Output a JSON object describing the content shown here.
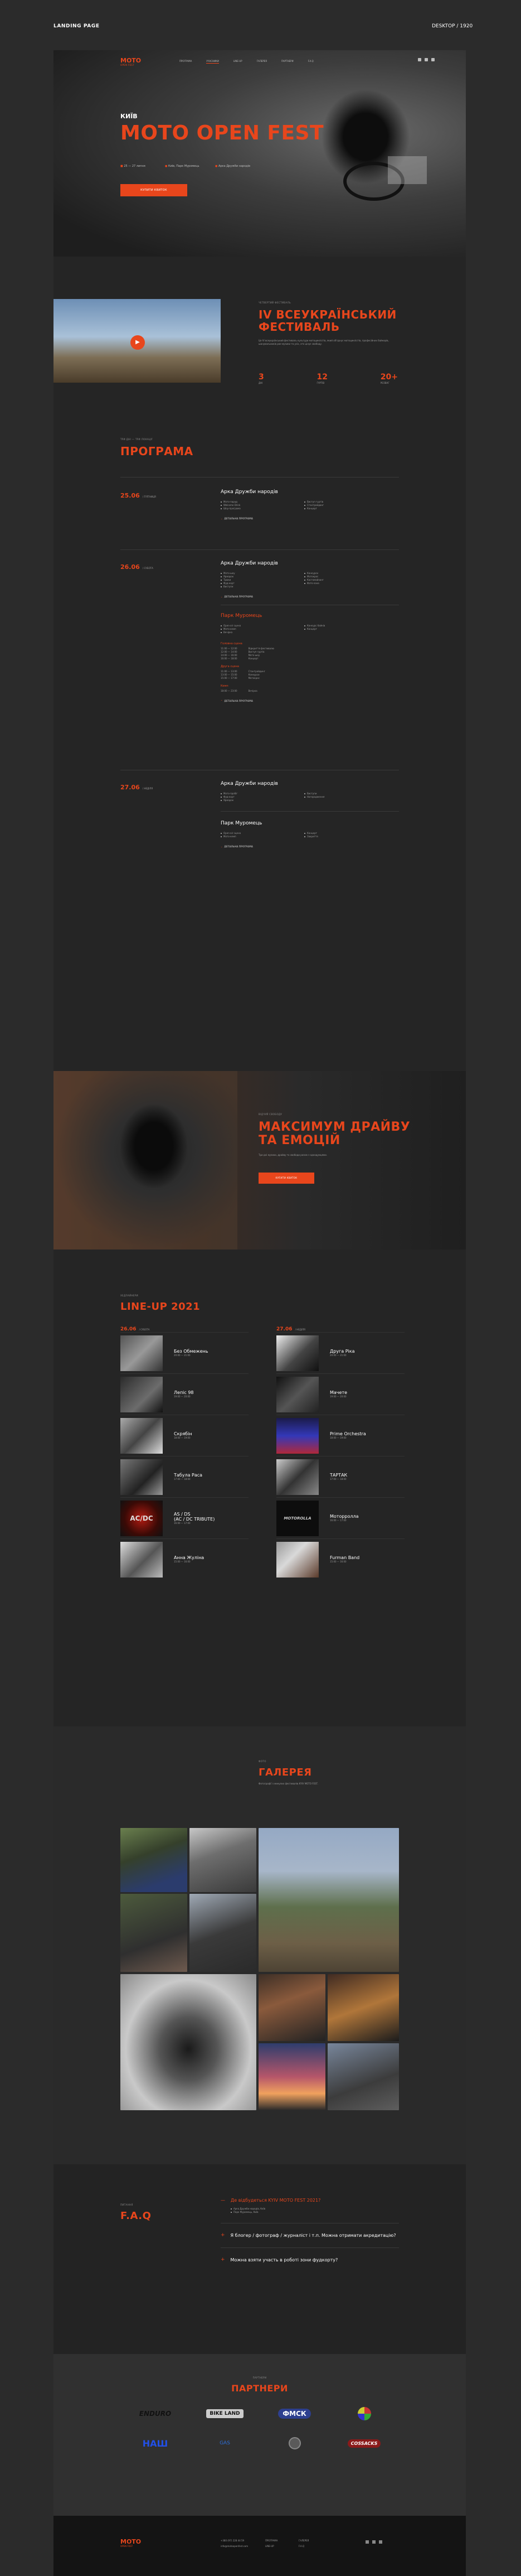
{
  "header": {
    "left": "LANDING PAGE",
    "right": "DESKTOP / 1920"
  },
  "nav": {
    "logo_top": "MOTO",
    "logo_bottom": "OPEN FEST",
    "items": [
      "ПРОГРАМА",
      "УЧАСНИКИ",
      "LINE-UP",
      "ГАЛЕРЕЯ",
      "ПАРТНЕРИ",
      "F.A.Q"
    ],
    "active": 1
  },
  "hero": {
    "city": "КИЇВ",
    "title": "MOTO OPEN FEST",
    "date": "25 — 27 липня",
    "place": "Київ, Парк Муромець",
    "extra": "Арка Дружби народів",
    "cta": "КУПИТИ КВИТОК"
  },
  "festival": {
    "sub": "ЧЕТВЕРТИЙ ФЕСТИВАЛЬ",
    "title1": "IV ВСЕУКРАЇНСЬКИЙ",
    "title2": "ФЕСТИВАЛЬ",
    "desc": "Це IV всеукраїнський фестиваль культури мотоциклістів, який об'єднує мотоциклістів, професійних байкерів, шанувальників рок-музики та усіх, хто цінує свободу.",
    "stats": [
      {
        "n": "3",
        "t": "ДНІ"
      },
      {
        "n": "12",
        "t": "ГУРТІВ"
      },
      {
        "n": "20+",
        "t": "РОЗВАГ"
      }
    ]
  },
  "program": {
    "sub": "ТРИ ДНІ — ТРИ ЛОКАЦІЇ",
    "title": "ПРОГРАМА",
    "more": "ДЕТАЛЬНА ПРОГРАМА",
    "days": [
      {
        "date": "25.06",
        "day": "/ П'ЯТНИЦЯ",
        "blocks": [
          {
            "place": "Арка Дружби народів",
            "a": [
              "Мото-парад",
              "Welcome Drink",
              "Шоу-програма"
            ],
            "b": [
              "Виступ гуртів",
              "Стантрайдинг",
              "Концерт"
            ]
          }
        ]
      },
      {
        "date": "26.06",
        "day": "/ СУБОТА",
        "blocks": [
          {
            "place": "Арка Дружби народів",
            "a": [
              "Мото-шоу",
              "Ярмарок",
              "Трюки",
              "Фуд-корт",
              "Виступи"
            ],
            "b": [
              "Конкурси",
              "Мотокрос",
              "Кастомайзинг",
              "Фото-зона"
            ]
          },
          {
            "place": "Парк Муромець",
            "a": [
              "Open-air сцена",
              "Мото-кемп",
              "Вечірка"
            ],
            "b": [
              "Конкурс байків",
              "Концерт"
            ]
          }
        ],
        "schedule": [
          {
            "h": "Головна сцена",
            "rows": [
              {
                "t": "11:00 — 12:00",
                "e": "Відкриття фестивалю"
              },
              {
                "t": "12:00 — 14:00",
                "e": "Виступ гуртів"
              },
              {
                "t": "14:00 — 16:00",
                "e": "Мото-шоу"
              },
              {
                "t": "16:00 — 18:00",
                "e": "Концерт"
              }
            ]
          },
          {
            "h": "Друга сцена",
            "rows": [
              {
                "t": "11:00 — 13:00",
                "e": "Стантрайдинг"
              },
              {
                "t": "13:00 — 15:00",
                "e": "Конкурси"
              },
              {
                "t": "15:00 — 17:00",
                "e": "Мотокрос"
              }
            ]
          },
          {
            "h": "Кемп",
            "rows": [
              {
                "t": "18:00 — 23:00",
                "e": "Вечірка"
              }
            ]
          }
        ]
      },
      {
        "date": "27.06",
        "day": "/ НЕДІЛЯ",
        "blocks": [
          {
            "place": "Арка Дружби народів",
            "a": [
              "Мото-пробіг",
              "Фуд-корт",
              "Ярмарок"
            ],
            "b": [
              "Виступи",
              "Нагородження"
            ]
          },
          {
            "place": "Парк Муромець",
            "a": [
              "Open-air сцена",
              "Мото-кемп"
            ],
            "b": [
              "Концерт",
              "Закриття"
            ]
          }
        ]
      }
    ]
  },
  "promo": {
    "sub": "ВІДЧУЙ СВОБОДУ",
    "title1": "МАКСИМУМ ДРАЙВУ",
    "title2": "ТА ЕМОЦІЙ",
    "desc": "Три дні музики, драйву та свободи разом з однодумцями.",
    "cta": "КУПИТИ КВИТОК"
  },
  "lineup": {
    "sub": "ХЕДЛАЙНЕРИ",
    "title": "LINE-UP 2021",
    "d1": {
      "date": "26.06",
      "day": "/ СУБОТА"
    },
    "d2": {
      "date": "27.06",
      "day": "/ НЕДІЛЯ"
    },
    "col1": [
      {
        "name": "Без Обмежень",
        "time": "20:00 — 21:00"
      },
      {
        "name": "Лепіс 98",
        "time": "19:00 — 20:00"
      },
      {
        "name": "Скрябін",
        "time": "18:00 — 19:00"
      },
      {
        "name": "Табула Раса",
        "time": "17:00 — 18:00"
      },
      {
        "name": "AS / DS",
        "name2": "(AC / DC TRIBUTE)",
        "time": "16:00 — 17:00"
      },
      {
        "name": "Анна Жуліна",
        "time": "15:00 — 16:00"
      }
    ],
    "col2": [
      {
        "name": "Друга Ріка",
        "time": "20:00 — 21:00"
      },
      {
        "name": "Мачете",
        "time": "19:00 — 20:00"
      },
      {
        "name": "Prime Orchestra",
        "time": "18:00 — 19:00"
      },
      {
        "name": "ТАРТАК",
        "time": "17:00 — 18:00"
      },
      {
        "name": "Моторролла",
        "time": "16:00 — 17:00"
      },
      {
        "name": "Furman Band",
        "time": "15:00 — 16:00"
      }
    ]
  },
  "gallery": {
    "sub": "ФОТО",
    "title": "ГАЛЕРЕЯ",
    "desc": "Фотографії з минулих фестивалів KYIV MOTO FEST."
  },
  "faq": {
    "sub": "ПИТАННЯ",
    "title": "F.A.Q",
    "items": [
      {
        "q": "Де відбудеться KYIV MOTO FEST 2021?",
        "open": true,
        "a1": "Арка Дружби народів, Київ",
        "a2": "Парк Муромець, Київ"
      },
      {
        "q": "Я блогер / фотограф / журналіст і т.п. Можна отримати акредитацію?"
      },
      {
        "q": "Можна взяти участь в роботі зони фудкорту?"
      }
    ]
  },
  "partners": {
    "sub": "ПАРТНЕРИ",
    "title": "ПАРТНЕРИ",
    "logos": [
      "ENDURO",
      "BIKE LAND",
      "ФМСК",
      "",
      "НАШ",
      "GAS",
      "",
      "COSSACKS"
    ]
  },
  "footer": {
    "logo_top": "MOTO",
    "logo_bottom": "OPEN FEST",
    "phone": "+380 (97) 228 44 59",
    "mail": "info@motoopenfest.com",
    "links": [
      "ПРОГРАМА",
      "LINE-UP",
      "ГАЛЕРЕЯ",
      "F.A.Q"
    ]
  },
  "colors": {
    "accent": "#e8461c",
    "bg": "#1c1c1c",
    "canvas": "#2b2b2b"
  }
}
